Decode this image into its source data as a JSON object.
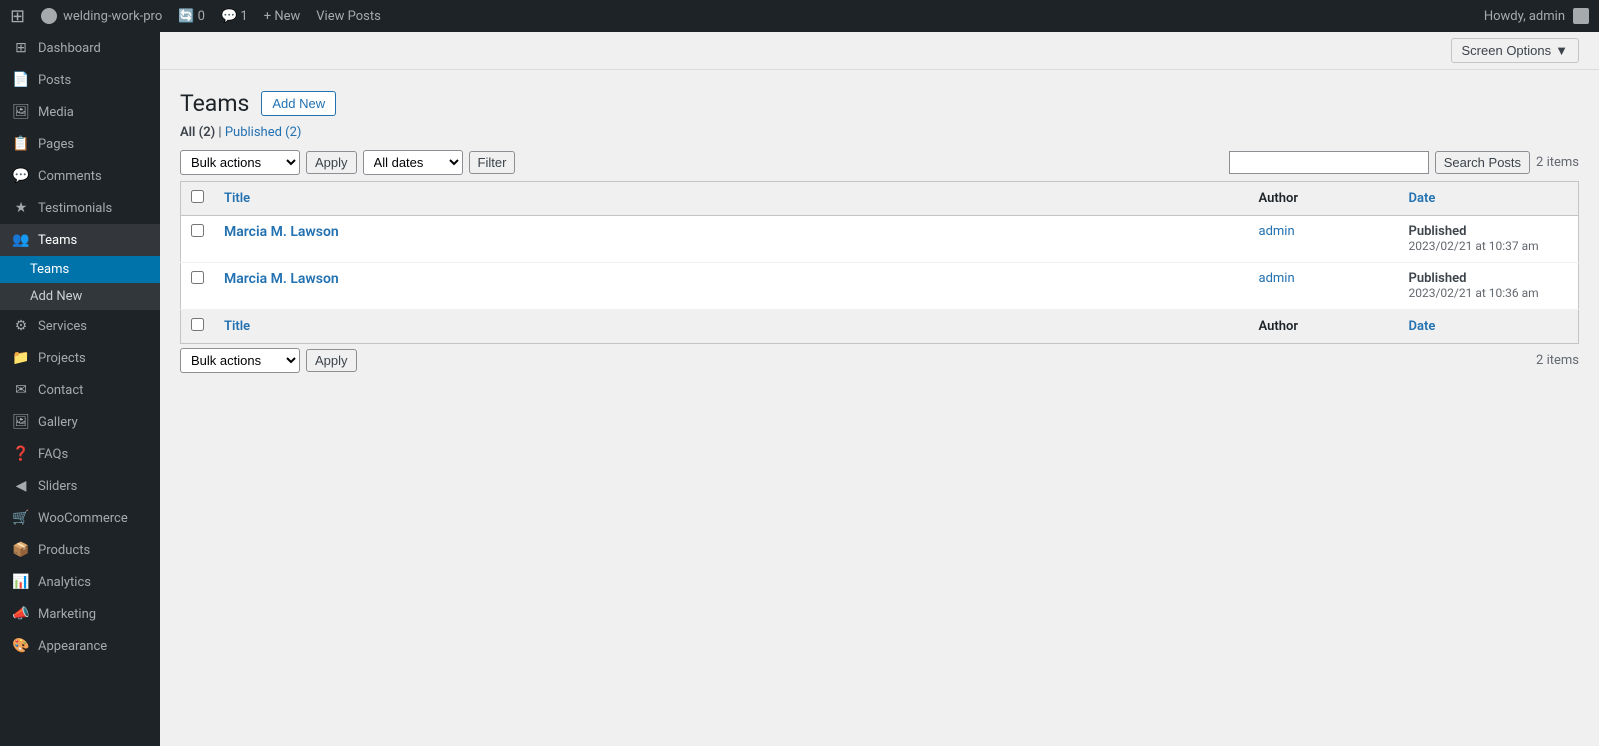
{
  "adminbar": {
    "logo": "W",
    "site_name": "welding-work-pro",
    "comments_count": "1",
    "comments_icon": "💬",
    "updates_count": "0",
    "new_label": "+ New",
    "view_posts_label": "View Posts",
    "howdy": "Howdy, admin"
  },
  "sidebar": {
    "items": [
      {
        "id": "dashboard",
        "icon": "⊞",
        "label": "Dashboard"
      },
      {
        "id": "posts",
        "icon": "📄",
        "label": "Posts"
      },
      {
        "id": "media",
        "icon": "🖼",
        "label": "Media"
      },
      {
        "id": "pages",
        "icon": "📋",
        "label": "Pages"
      },
      {
        "id": "comments",
        "icon": "💬",
        "label": "Comments"
      },
      {
        "id": "testimonials",
        "icon": "★",
        "label": "Testimonials"
      },
      {
        "id": "teams",
        "icon": "👥",
        "label": "Teams",
        "active": true
      },
      {
        "id": "services",
        "icon": "⚙",
        "label": "Services"
      },
      {
        "id": "projects",
        "icon": "📁",
        "label": "Projects"
      },
      {
        "id": "contact",
        "icon": "✉",
        "label": "Contact"
      },
      {
        "id": "gallery",
        "icon": "🖼",
        "label": "Gallery"
      },
      {
        "id": "faqs",
        "icon": "❓",
        "label": "FAQs"
      },
      {
        "id": "sliders",
        "icon": "◀",
        "label": "Sliders"
      },
      {
        "id": "woocommerce",
        "icon": "🛒",
        "label": "WooCommerce"
      },
      {
        "id": "products",
        "icon": "📦",
        "label": "Products"
      },
      {
        "id": "analytics",
        "icon": "📊",
        "label": "Analytics"
      },
      {
        "id": "marketing",
        "icon": "📣",
        "label": "Marketing"
      },
      {
        "id": "appearance",
        "icon": "🎨",
        "label": "Appearance"
      }
    ],
    "submenu": {
      "parent": "teams",
      "items": [
        {
          "id": "teams-all",
          "label": "Teams",
          "active": true
        },
        {
          "id": "teams-add-new",
          "label": "Add New"
        }
      ]
    }
  },
  "screen_options": {
    "label": "Screen Options",
    "arrow": "▼"
  },
  "page": {
    "title": "Teams",
    "add_new_label": "Add New"
  },
  "filter_links": {
    "all_label": "All",
    "all_count": "(2)",
    "separator": "|",
    "published_label": "Published",
    "published_count": "(2)"
  },
  "toolbar_top": {
    "bulk_actions_label": "Bulk actions",
    "apply_label": "Apply",
    "all_dates_label": "All dates",
    "filter_label": "Filter",
    "items_count": "2 items",
    "search_placeholder": "",
    "search_posts_label": "Search Posts"
  },
  "table": {
    "col_title": "Title",
    "col_author": "Author",
    "col_date": "Date",
    "rows": [
      {
        "id": 1,
        "title": "Marcia M. Lawson",
        "author": "admin",
        "date_status": "Published",
        "date_value": "2023/02/21 at 10:37 am"
      },
      {
        "id": 2,
        "title": "Marcia M. Lawson",
        "author": "admin",
        "date_status": "Published",
        "date_value": "2023/02/21 at 10:36 am"
      }
    ]
  },
  "toolbar_bottom": {
    "bulk_actions_label": "Bulk actions",
    "apply_label": "Apply",
    "items_count": "2 items"
  }
}
